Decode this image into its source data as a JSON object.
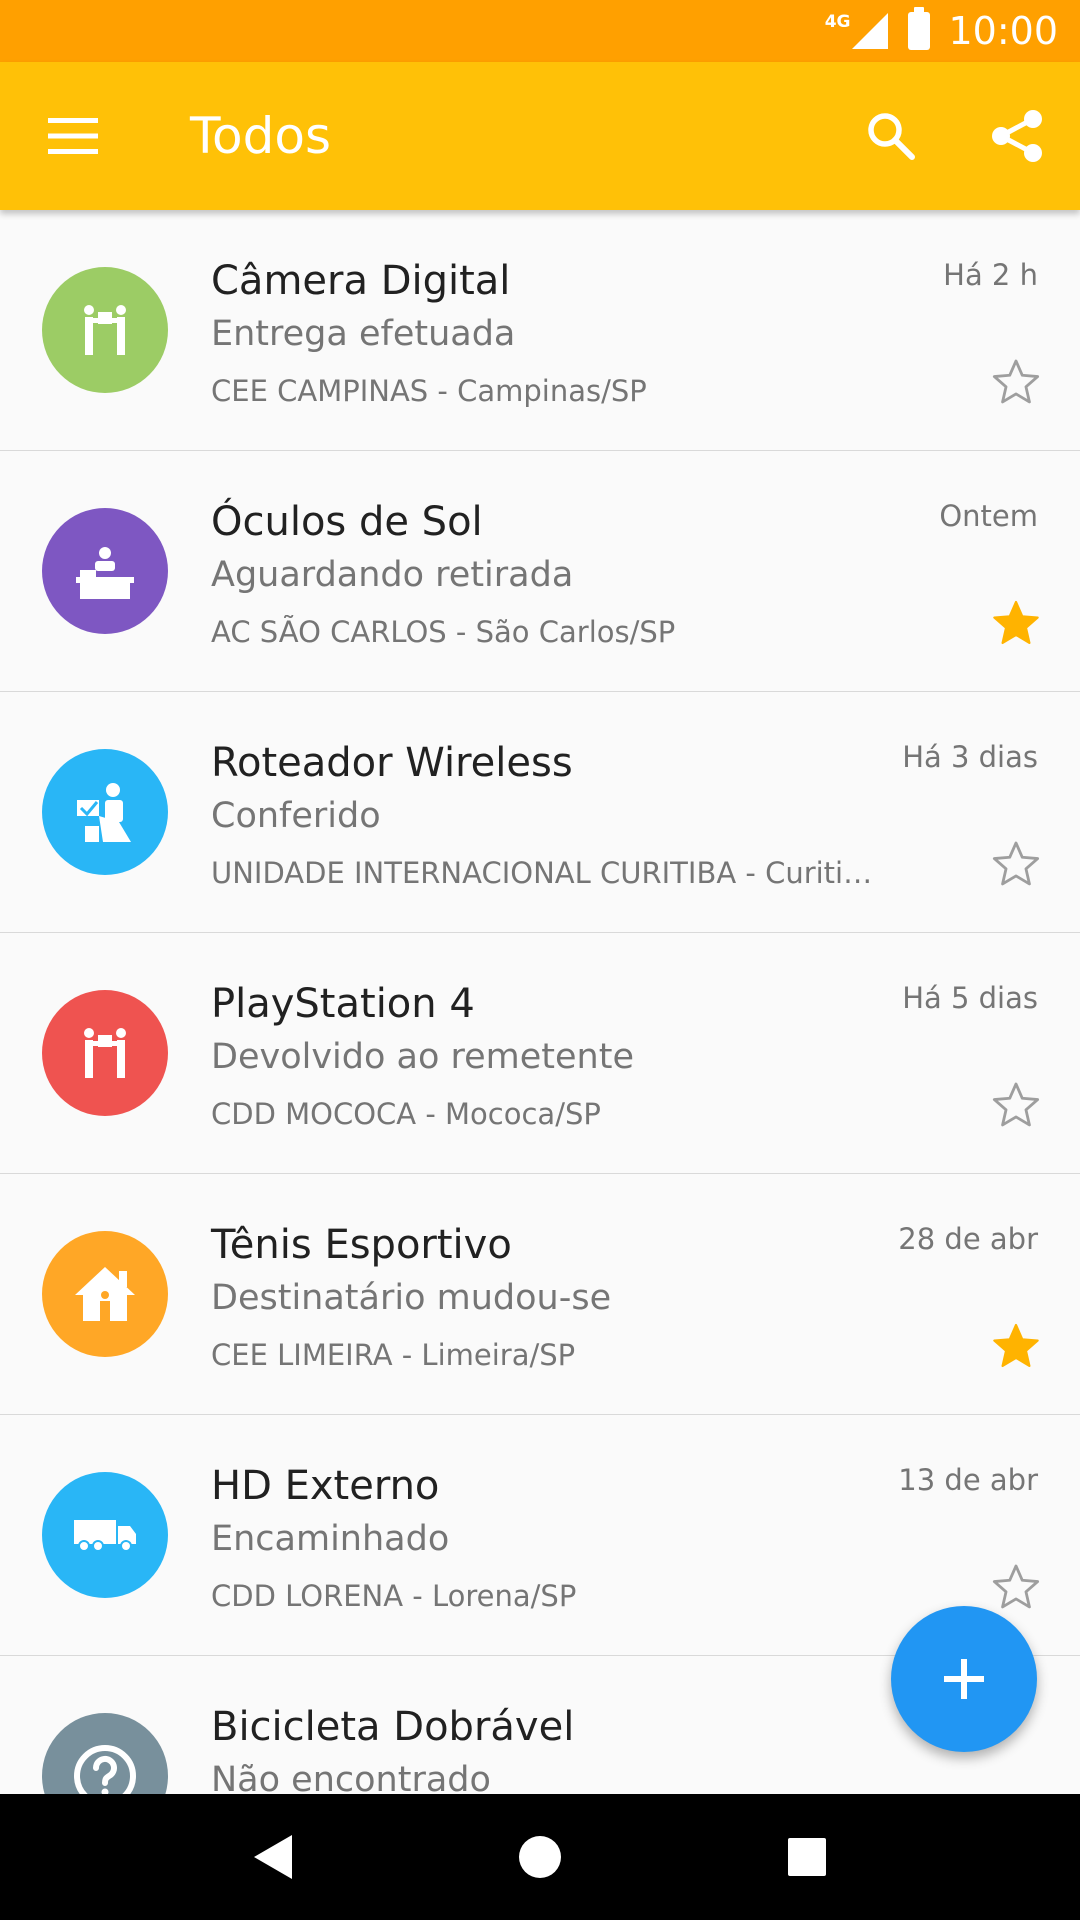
{
  "status_bar": {
    "network": "4G",
    "time": "10:00",
    "color": "#ffa000"
  },
  "toolbar": {
    "title": "Todos",
    "color": "#ffc107",
    "icons": [
      "menu-icon",
      "search-icon",
      "share-icon"
    ]
  },
  "items": [
    {
      "title": "Câmera Digital",
      "status": "Entrega efetuada",
      "location": "CEE CAMPINAS - Campinas/SP",
      "time": "Há 2 h",
      "starred": false,
      "avatar_color": "#9ccc65",
      "icon": "handover-icon"
    },
    {
      "title": "Óculos de Sol",
      "status": "Aguardando retirada",
      "location": "AC SÃO CARLOS - São Carlos/SP",
      "time": "Ontem",
      "starred": true,
      "avatar_color": "#7e57c2",
      "icon": "counter-icon"
    },
    {
      "title": "Roteador Wireless",
      "status": "Conferido",
      "location": "UNIDADE INTERNACIONAL CURITIBA - Curitiba/PR",
      "time": "Há 3 dias",
      "starred": false,
      "avatar_color": "#29b6f6",
      "icon": "inspection-icon"
    },
    {
      "title": "PlayStation 4",
      "status": "Devolvido ao remetente",
      "location": "CDD MOCOCA - Mococa/SP",
      "time": "Há 5 dias",
      "starred": false,
      "avatar_color": "#ef5350",
      "icon": "handover-icon"
    },
    {
      "title": "Tênis Esportivo",
      "status": "Destinatário mudou-se",
      "location": "CEE LIMEIRA - Limeira/SP",
      "time": "28 de abr",
      "starred": true,
      "avatar_color": "#ffa726",
      "icon": "house-icon"
    },
    {
      "title": "HD Externo",
      "status": "Encaminhado",
      "location": "CDD LORENA - Lorena/SP",
      "time": "13 de abr",
      "starred": false,
      "avatar_color": "#29b6f6",
      "icon": "truck-icon"
    },
    {
      "title": "Bicicleta Dobrável",
      "status": "Não encontrado",
      "location": "",
      "time": "",
      "starred": false,
      "avatar_color": "#78909c",
      "icon": "question-icon"
    }
  ],
  "fab": {
    "icon": "plus-icon",
    "color": "#2196f3"
  },
  "star_color": "#ffb300",
  "nav_bar": {
    "icons": [
      "back-icon",
      "home-icon",
      "recents-icon"
    ]
  }
}
